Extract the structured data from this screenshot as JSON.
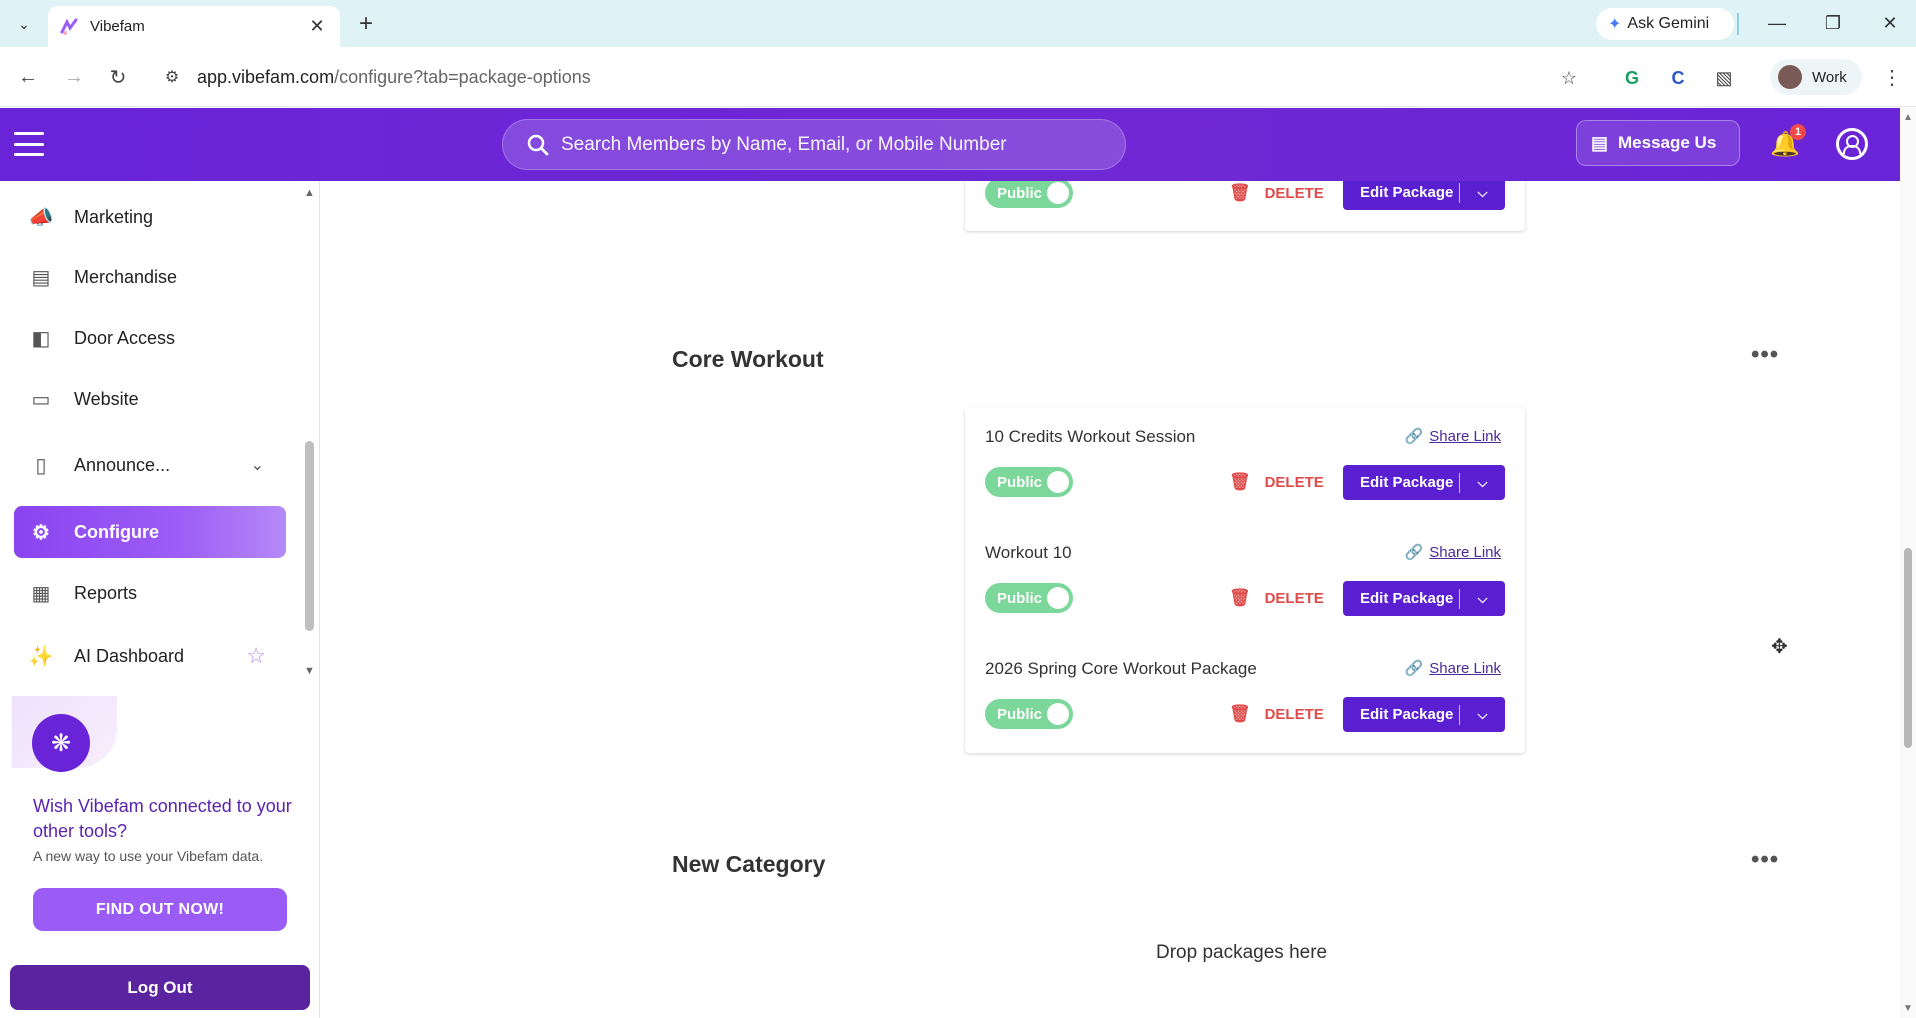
{
  "browser": {
    "tab_title": "Vibefam",
    "url_host": "app.vibefam.com",
    "url_path": "/configure?tab=package-options",
    "gemini_label": "Ask Gemini",
    "profile_label": "Work"
  },
  "header": {
    "search_placeholder": "Search Members by Name, Email, or Mobile Number",
    "message_label": "Message Us",
    "notification_count": "1"
  },
  "sidebar": {
    "items": [
      {
        "label": "Marketing",
        "icon": "megaphone-icon"
      },
      {
        "label": "Merchandise",
        "icon": "store-icon"
      },
      {
        "label": "Door Access",
        "icon": "door-lock-icon"
      },
      {
        "label": "Website",
        "icon": "laptop-icon"
      },
      {
        "label": "Announce...",
        "icon": "phone-icon"
      },
      {
        "label": "Configure",
        "icon": "gear-icon"
      },
      {
        "label": "Reports",
        "icon": "table-icon"
      },
      {
        "label": "AI Dashboard",
        "icon": "sparkle-icon"
      }
    ],
    "promo": {
      "title": "Wish Vibefam connected to your other tools?",
      "subtitle": "A new way to use your Vibefam data.",
      "button": "FIND OUT NOW!"
    },
    "logout": "Log Out"
  },
  "main": {
    "labels": {
      "public": "Public",
      "delete": "DELETE",
      "edit": "Edit Package",
      "share": "Share Link"
    },
    "categories": [
      {
        "title": "Core Workout",
        "packages": [
          {
            "name": "10 Credits Workout Session"
          },
          {
            "name": "Workout 10"
          },
          {
            "name": "2026 Spring Core Workout Package"
          }
        ]
      },
      {
        "title": "New Category",
        "empty_text": "Drop packages here"
      }
    ]
  },
  "colors": {
    "brand": "#6a24d8",
    "button": "#5a1fd0",
    "toggle_on": "#7cd79a",
    "delete": "#e14a4a"
  }
}
